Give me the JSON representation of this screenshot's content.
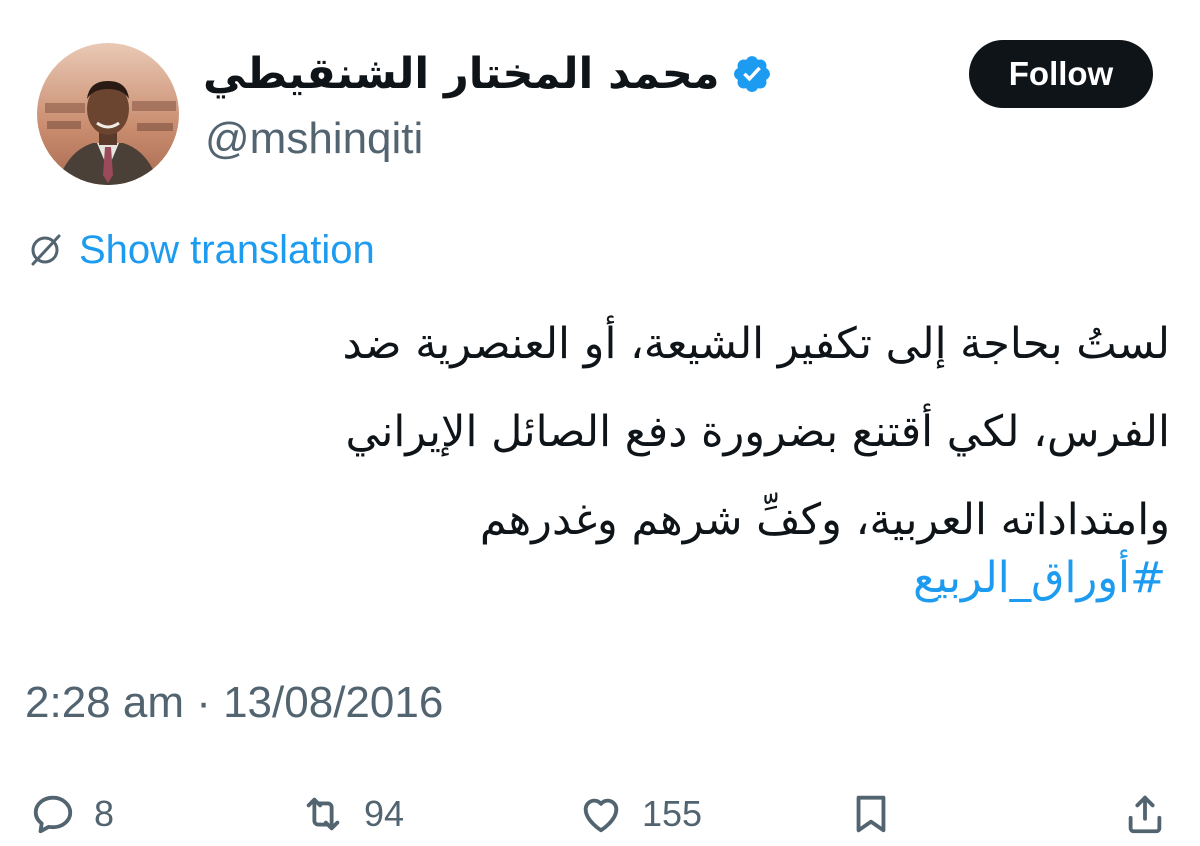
{
  "user": {
    "display_name": "محمد المختار الشنقيطي",
    "handle": "@mshinqiti",
    "verified_icon": "verified-badge-icon",
    "verified_color": "#1d9bf0"
  },
  "follow_button": {
    "label": "Follow"
  },
  "translation": {
    "label": "Show translation",
    "icon": "translate-globe-icon"
  },
  "tweet": {
    "lines": [
      "لستُ بحاجة إلى تكفير الشيعة، أو العنصرية ضد",
      "الفرس، لكي أقتنع بضرورة دفع الصائل الإيراني",
      "وامتداداته العربية، وكفِّ شرهم وغدرهم"
    ],
    "hashtag": "#أوراق_الربيع"
  },
  "timestamp": "2:28 am · 13/08/2016",
  "actions": {
    "replies": {
      "icon": "reply-icon",
      "count": "8"
    },
    "retweets": {
      "icon": "retweet-icon",
      "count": "94"
    },
    "likes": {
      "icon": "heart-icon",
      "count": "155"
    },
    "bookmark": {
      "icon": "bookmark-icon"
    },
    "share": {
      "icon": "share-icon"
    }
  },
  "colors": {
    "link": "#1d9bf0",
    "secondary_text": "#536471",
    "primary_text": "#0f1419",
    "follow_bg": "#0f1419"
  }
}
